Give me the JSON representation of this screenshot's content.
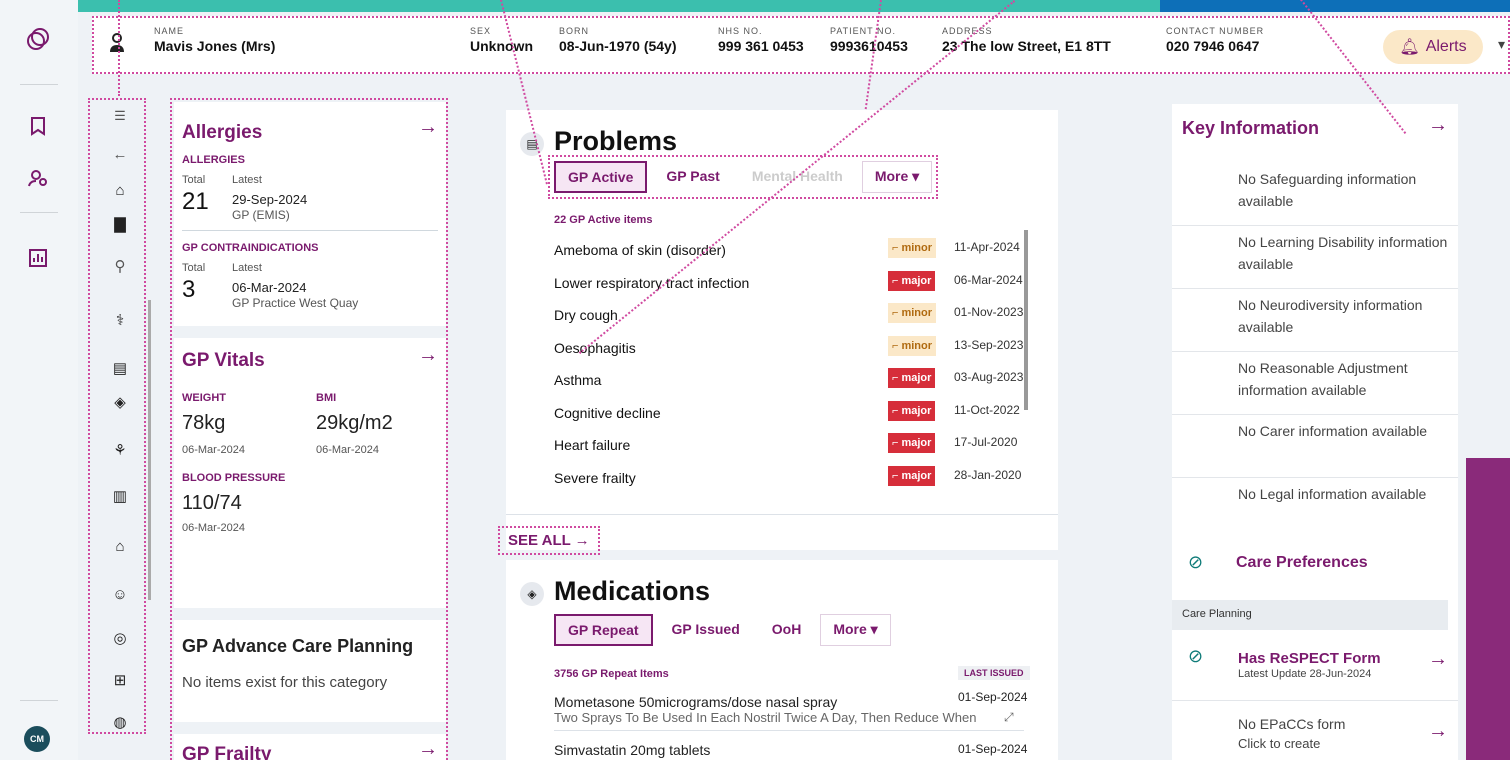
{
  "banner": {
    "name_label": "NAME",
    "name": "Mavis Jones (Mrs)",
    "sex_label": "SEX",
    "sex": "Unknown",
    "born_label": "BORN",
    "born": "08-Jun-1970 (54y)",
    "nhs_label": "NHS NO.",
    "nhs": "999 361 0453",
    "patient_label": "PATIENT NO.",
    "patient": "9993610453",
    "address_label": "ADDRESS",
    "address": "23 The low Street, E1 8TT",
    "contact_label": "CONTACT NUMBER",
    "contact": "020 7946 0647",
    "alerts": "Alerts"
  },
  "rail": {
    "avatar": "CM"
  },
  "allergies": {
    "title": "Allergies",
    "section1": "ALLERGIES",
    "total_label": "Total",
    "latest_label": "Latest",
    "total": "21",
    "latest_date": "29-Sep-2024",
    "latest_src": "GP (EMIS)",
    "section2": "GP CONTRAINDICATIONS",
    "total2": "3",
    "latest2_date": "06-Mar-2024",
    "latest2_src": "GP Practice West Quay"
  },
  "vitals": {
    "title": "GP Vitals",
    "weight_label": "WEIGHT",
    "weight": "78kg",
    "weight_date": "06-Mar-2024",
    "bmi_label": "BMI",
    "bmi": "29kg/m2",
    "bmi_date": "06-Mar-2024",
    "bp_label": "BLOOD PRESSURE",
    "bp": "110/74",
    "bp_date": "06-Mar-2024"
  },
  "acp": {
    "title": "GP Advance Care Planning",
    "empty": "No items exist for this category"
  },
  "frailty": {
    "title": "GP Frailty"
  },
  "problems": {
    "title": "Problems",
    "tabs": [
      "GP Active",
      "GP Past",
      "Mental Health",
      "More ▾"
    ],
    "count": "22 GP Active items",
    "rows": [
      {
        "name": "Ameboma of skin (disorder)",
        "sev": "minor",
        "date": "11-Apr-2024"
      },
      {
        "name": "Lower respiratory tract infection",
        "sev": "major",
        "date": "06-Mar-2024"
      },
      {
        "name": "Dry cough",
        "sev": "minor",
        "date": "01-Nov-2023"
      },
      {
        "name": "Oesophagitis",
        "sev": "minor",
        "date": "13-Sep-2023"
      },
      {
        "name": "Asthma",
        "sev": "major",
        "date": "03-Aug-2023"
      },
      {
        "name": "Cognitive decline",
        "sev": "major",
        "date": "11-Oct-2022"
      },
      {
        "name": "Heart failure",
        "sev": "major",
        "date": "17-Jul-2020"
      },
      {
        "name": "Severe frailty",
        "sev": "major",
        "date": "28-Jan-2020"
      }
    ],
    "see_all": "SEE ALL"
  },
  "medications": {
    "title": "Medications",
    "tabs": [
      "GP Repeat",
      "GP Issued",
      "OoH",
      "More ▾"
    ],
    "count": "3756 GP Repeat Items",
    "last_issued": "LAST ISSUED",
    "items": [
      {
        "name": "Mometasone 50micrograms/dose nasal spray",
        "date": "01-Sep-2024",
        "detail": "Two Sprays To Be Used In Each Nostril Twice A Day, Then Reduce When"
      },
      {
        "name": "Simvastatin 20mg tablets",
        "date": "01-Sep-2024",
        "detail": ""
      }
    ]
  },
  "keyinfo": {
    "title": "Key Information",
    "items": [
      "No Safeguarding information available",
      "No Learning Disability information available",
      "No Neurodiversity information available",
      "No Reasonable Adjustment information available",
      "No Carer information available",
      "No Legal information available"
    ],
    "care_prefs": "Care Preferences",
    "care_planning": "Care Planning",
    "respect": "Has ReSPECT Form",
    "respect_date": "Latest Update 28-Jun-2024",
    "epaccs": "No EPaCCs form",
    "epaccs_sub": "Click to create"
  },
  "colors": {
    "accent": "#7a1a6d",
    "major": "#d62e3a",
    "minor": "#fbe8c8",
    "teal": "#3bbfae"
  }
}
